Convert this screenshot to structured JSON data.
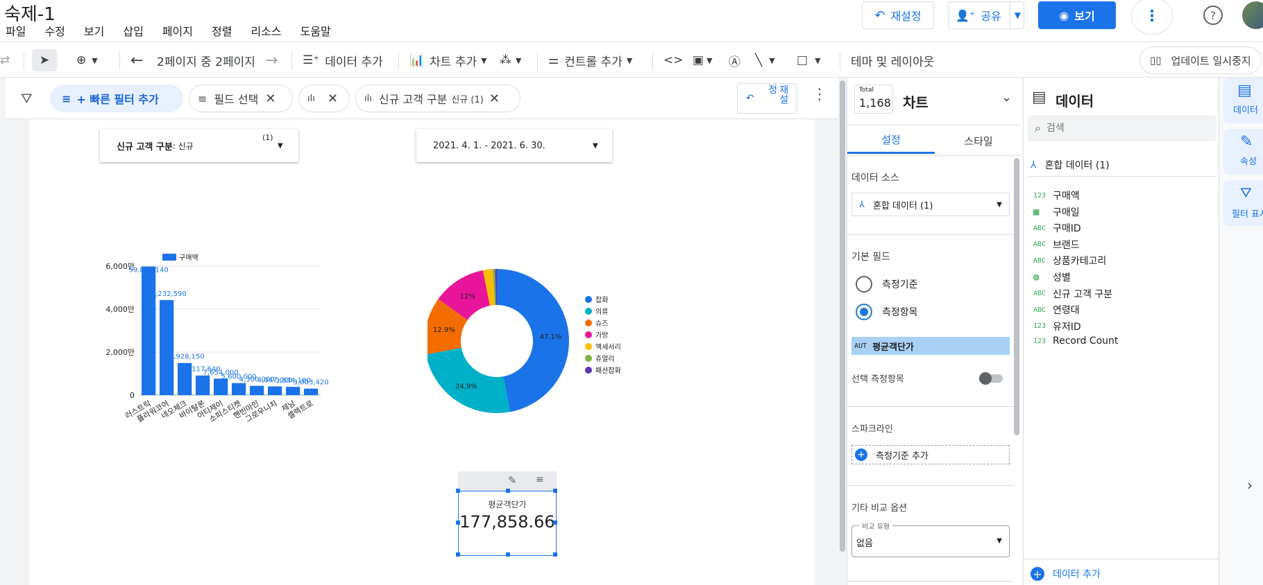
{
  "app": {
    "title": "숙제-1",
    "menu": [
      "파일",
      "수정",
      "보기",
      "삽입",
      "페이지",
      "정렬",
      "리소스",
      "도움말"
    ],
    "reset_label": "재설정",
    "share_label": "공유",
    "view_label": "보기"
  },
  "toolbar": {
    "page_nav": "2페이지 중 2페이지",
    "add_data": "데이터 추가",
    "add_chart": "차트 추가",
    "add_control": "컨트롤 추가",
    "theme_layout": "테마 및 레이아웃",
    "pause_updates": "업데이트 일시중지"
  },
  "filterbar": {
    "quick_filter": "+ 빠른 필터 추가",
    "field_select": "필드 선택",
    "chip_filter_label": "신규 고객 구분",
    "chip_filter_value": "신규 (1)",
    "reset_label": "재설정"
  },
  "controls": {
    "customer_type_label": "신규 고객 구분",
    "customer_type_value": ": 신규",
    "customer_type_count": "(1)",
    "date_range": "2021. 4. 1. - 2021. 6. 30."
  },
  "scorecard": {
    "label": "평균객단가",
    "value": "177,858.66"
  },
  "colors": {
    "bar": "#1a73e8",
    "accent": "#1a73e8",
    "pie": [
      "#1a73e8",
      "#00b0c8",
      "#f36c00",
      "#e8159a",
      "#fbbc04",
      "#7cb342",
      "#5e35b1"
    ]
  },
  "chart_data": [
    {
      "type": "bar",
      "legend": "구매액",
      "categories": [
        "러스트릭",
        "플라워코어",
        "네오체크",
        "바이탈론",
        "아티제이",
        "소피스티켓",
        "핸빈마인",
        "그로우니치",
        "제닝",
        "셀렉트로"
      ],
      "values": [
        59814140,
        44232590,
        14928150,
        9117640,
        7654000,
        5600000,
        4300000,
        4047000,
        3834180,
        3003420
      ],
      "value_labels": [
        "59,814,140",
        "44,232,590",
        "14,928,150",
        "9,117,640",
        "7,654,000",
        "5,600,000",
        "4,300,000",
        "4,047,000",
        "3,834,180",
        "3,003,420"
      ],
      "y_ticks": [
        "0",
        "2,000만",
        "4,000만",
        "6,000만"
      ],
      "ylim": [
        0,
        60000000
      ]
    },
    {
      "type": "pie",
      "categories": [
        "잡화",
        "의류",
        "슈즈",
        "가방",
        "액세서리",
        "쥬얼리",
        "패션잡화"
      ],
      "values": [
        47.1,
        24.9,
        12.9,
        12.0,
        2.2,
        0.5,
        0.4
      ],
      "labels": [
        "47.1%",
        "24.9%",
        "12.9%",
        "12%",
        "",
        "",
        ""
      ]
    }
  ],
  "prop_panel": {
    "total_label": "Total",
    "total_value": "1,168",
    "title": "차트",
    "tab_setup": "설정",
    "tab_style": "스타일",
    "data_source_label": "데이터 소스",
    "data_source_value": "혼합 데이터 (1)",
    "default_field_label": "기본 필드",
    "radio_dimension": "측정기준",
    "radio_metric": "측정항목",
    "metric_chip_type": "AUT",
    "metric_chip_label": "평균객단가",
    "select_metric_label": "선택 측정항목",
    "sparkline_label": "스파크라인",
    "add_dimension_label": "측정기준 추가",
    "compare_options_label": "기타 비교 옵션",
    "compare_type_label": "비교 유형",
    "compare_type_value": "없음"
  },
  "data_panel": {
    "title": "데이터",
    "search_placeholder": "검색",
    "source": "혼합 데이터 (1)",
    "fields": [
      {
        "type": "123",
        "name": "구매액"
      },
      {
        "type": "date",
        "name": "구매일"
      },
      {
        "type": "ABC",
        "name": "구매ID"
      },
      {
        "type": "ABC",
        "name": "브랜드"
      },
      {
        "type": "ABC",
        "name": "상품카테고리"
      },
      {
        "type": "geo",
        "name": "성별"
      },
      {
        "type": "ABC",
        "name": "신규 고객 구분"
      },
      {
        "type": "ABC",
        "name": "연령대"
      },
      {
        "type": "123",
        "name": "유저ID"
      },
      {
        "type": "123",
        "name": "Record Count"
      }
    ],
    "add_data_label": "데이터 추가"
  },
  "rail": {
    "data_label": "데이터",
    "props_label": "속성",
    "filter_label": "필터 표시"
  }
}
